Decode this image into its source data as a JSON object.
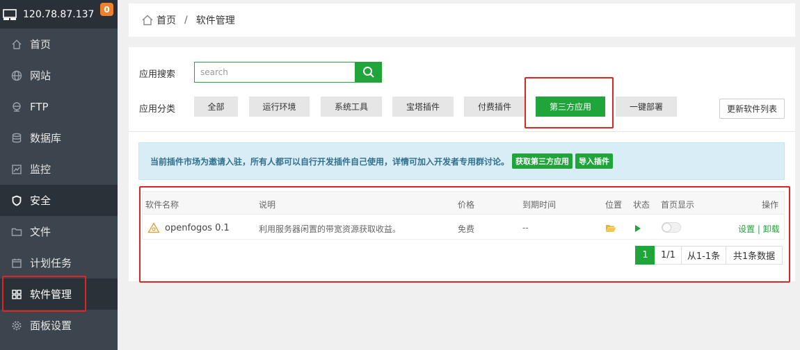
{
  "sidebar": {
    "ip": "120.78.87.137",
    "badge": "0",
    "items": [
      {
        "label": "首页"
      },
      {
        "label": "网站"
      },
      {
        "label": "FTP"
      },
      {
        "label": "数据库"
      },
      {
        "label": "监控"
      },
      {
        "label": "安全"
      },
      {
        "label": "文件"
      },
      {
        "label": "计划任务"
      },
      {
        "label": "软件管理"
      },
      {
        "label": "面板设置"
      }
    ]
  },
  "breadcrumb": {
    "home": "首页",
    "separator": "/",
    "current": "软件管理"
  },
  "search": {
    "label": "应用搜索",
    "placeholder": "search"
  },
  "category": {
    "label": "应用分类",
    "items": [
      "全部",
      "运行环境",
      "系统工具",
      "宝塔插件",
      "付费插件",
      "第三方应用",
      "一键部署"
    ],
    "active": "第三方应用"
  },
  "update_button": "更新软件列表",
  "notice": {
    "text": "当前插件市场为邀请入驻，所有人都可以自行开发插件自己使用，详情可加入开发者专用群讨论。",
    "btn_get": "获取第三方应用",
    "btn_import": "导入插件"
  },
  "table": {
    "headers": [
      "软件名称",
      "说明",
      "价格",
      "到期时间",
      "位置",
      "状态",
      "首页显示",
      "操作"
    ],
    "rows": [
      {
        "name": "openfogos 0.1",
        "desc": "利用服务器闲置的带宽资源获取收益。",
        "price": "免费",
        "expire": "--",
        "action_settings": "设置",
        "action_sep": "|",
        "action_uninstall": "卸载"
      }
    ]
  },
  "pager": {
    "current": "1",
    "pages": "1/1",
    "range": "从1-1条",
    "total": "共1条数据"
  },
  "colors": {
    "accent": "#20a53a",
    "sidebar": "#3c444d",
    "highlight": "#e02424",
    "badge": "#f0812b"
  }
}
